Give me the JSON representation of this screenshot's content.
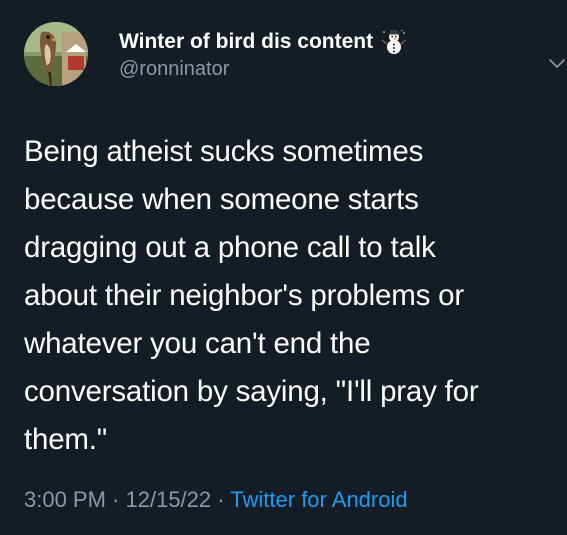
{
  "user": {
    "display_name": "Winter of bird dis content",
    "name_emoji_icon": "snowman-icon",
    "handle": "@ronninator",
    "avatar_icon": "bird-avatar"
  },
  "tweet": {
    "text_lines": [
      "Being atheist sucks sometimes",
      "because when someone starts",
      "dragging out a phone call to talk",
      "about their neighbor's problems or",
      "whatever you can't end the",
      "conversation by saying, \"I'll pray for",
      "them.\""
    ]
  },
  "meta": {
    "time": "3:00 PM",
    "separator1": " · ",
    "date": "12/15/22",
    "separator2": " · ",
    "source": "Twitter for Android"
  },
  "menu": {
    "icon": "chevron-down-icon"
  },
  "colors": {
    "background": "#141d26",
    "secondary_text": "#8b98a5",
    "link": "#1d9bf0"
  }
}
